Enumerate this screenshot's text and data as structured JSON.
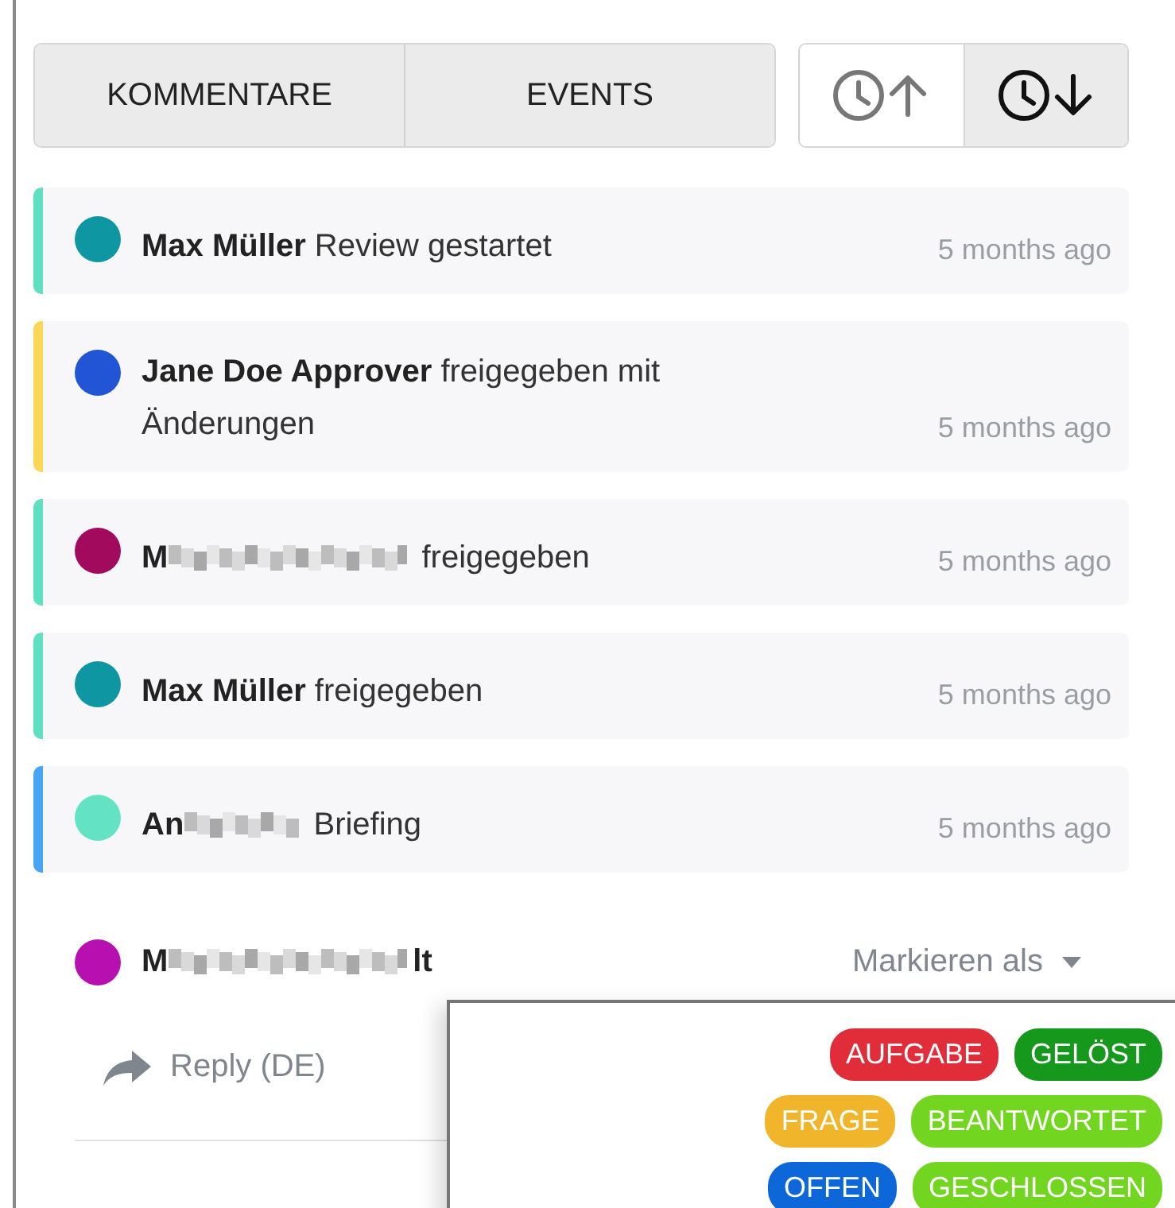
{
  "tabs": [
    {
      "label": "KOMMENTARE",
      "selected": false
    },
    {
      "label": "EVENTS",
      "selected": false
    }
  ],
  "sort_buttons": [
    {
      "kind": "up",
      "selected": false
    },
    {
      "kind": "down",
      "selected": true
    }
  ],
  "events": [
    {
      "color": "#5fe0bf",
      "avatar": {
        "color": "#0e97a3"
      },
      "name": [
        {
          "kind": "text",
          "text": "Max Müller"
        }
      ],
      "action": "Review gestartet",
      "time": "5 months ago"
    },
    {
      "color": "#fbd755",
      "avatar": {
        "color": "#2155d6"
      },
      "name": [
        {
          "kind": "text",
          "text": "Jane Doe Approver"
        }
      ],
      "action": "freigegeben mit Änderungen",
      "time": "5 months ago"
    },
    {
      "color": "#5fe0bf",
      "avatar": {
        "color": "#a10a5d"
      },
      "name": [
        {
          "kind": "text",
          "text": "M"
        },
        {
          "kind": "blur"
        }
      ],
      "action": "freigegeben",
      "time": "5 months ago"
    },
    {
      "color": "#5fe0bf",
      "avatar": {
        "color": "#0e97a3"
      },
      "name": [
        {
          "kind": "text",
          "text": "Max Müller"
        }
      ],
      "action": "freigegeben",
      "time": "5 months ago"
    },
    {
      "color": "#48a4f5",
      "avatar": {
        "color": "#63e3c4"
      },
      "name": [
        {
          "kind": "text",
          "text": "An"
        },
        {
          "kind": "blur"
        }
      ],
      "action": "Briefing",
      "time": "5 months ago"
    }
  ],
  "comment": {
    "avatar": {
      "color": "#b80fb0"
    },
    "name": [
      {
        "kind": "text",
        "text": "M"
      },
      {
        "kind": "blur"
      },
      {
        "kind": "text",
        "text": "lt"
      }
    ],
    "mark_menu": "Markieren als",
    "reply": "Reply (DE)"
  },
  "tag_menu": {
    "rows": [
      [
        {
          "label": "AUFGABE",
          "color": "#e12d39"
        },
        {
          "label": "GELÖST",
          "color": "#16981c"
        }
      ],
      [
        {
          "label": "FRAGE",
          "color": "#f0b52b"
        },
        {
          "label": "BEANTWORTET",
          "color": "#72d51f"
        }
      ],
      [
        {
          "label": "OFFEN",
          "color": "#0d67d8"
        },
        {
          "label": "GESCHLOSSEN",
          "color": "#72d51f"
        }
      ]
    ]
  }
}
